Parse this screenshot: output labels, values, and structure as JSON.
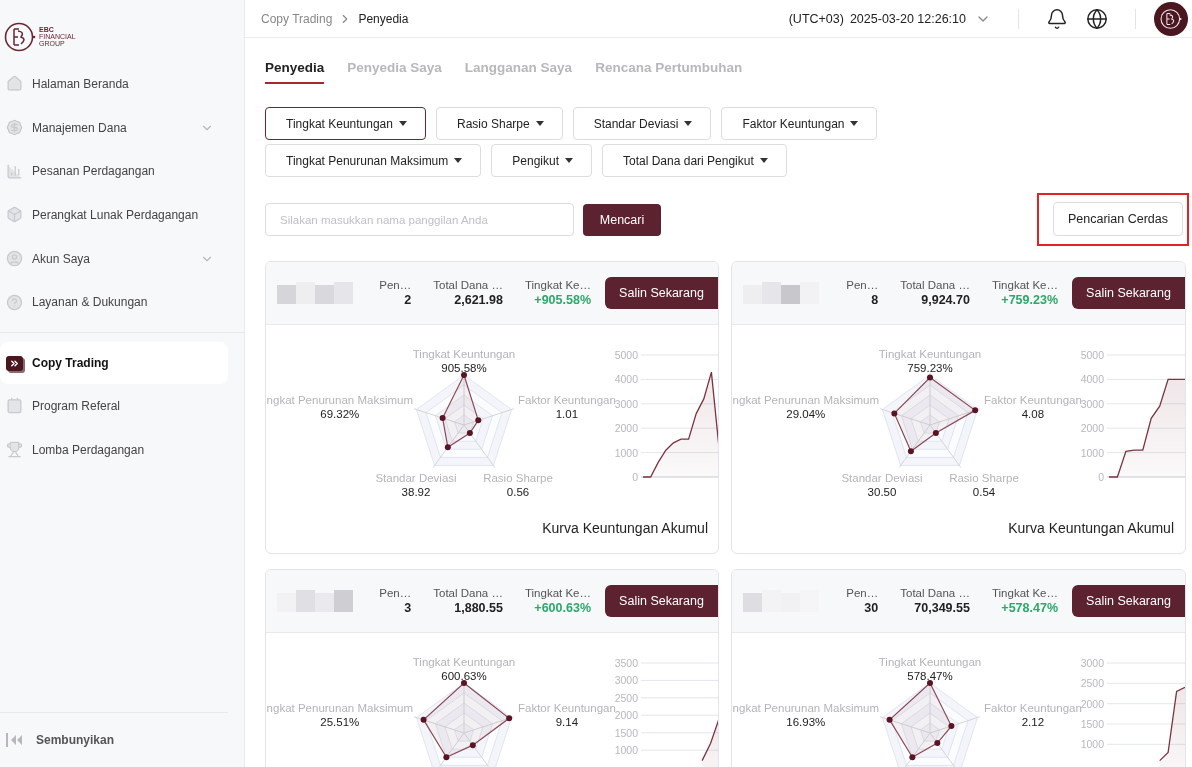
{
  "sidebar": {
    "logo": {
      "lines": [
        "EBC",
        "FINANCIAL",
        "GROUP"
      ]
    },
    "groups": [
      [
        {
          "label": "Halaman Beranda",
          "expandable": false,
          "selected": false
        },
        {
          "label": "Manajemen Dana",
          "expandable": true,
          "selected": false
        },
        {
          "label": "Pesanan Perdagangan",
          "expandable": false,
          "selected": false
        },
        {
          "label": "Perangkat Lunak Perdagangan",
          "expandable": false,
          "selected": false
        },
        {
          "label": "Akun Saya",
          "expandable": true,
          "selected": false
        },
        {
          "label": "Layanan & Dukungan",
          "expandable": false,
          "selected": false
        }
      ],
      [
        {
          "label": "Copy Trading",
          "expandable": false,
          "selected": true
        },
        {
          "label": "Program Referal",
          "expandable": false,
          "selected": false
        },
        {
          "label": "Lomba Perdagangan",
          "expandable": false,
          "selected": false
        }
      ]
    ],
    "collapse": "Sembunyikan"
  },
  "header": {
    "breadcrumb": [
      "Copy Trading",
      "Penyedia"
    ],
    "timezone": "(UTC+03)",
    "datetime": "2025-03-20 12:26:10"
  },
  "tabs": [
    {
      "label": "Penyedia",
      "selected": true
    },
    {
      "label": "Penyedia Saya",
      "selected": false
    },
    {
      "label": "Langganan Saya",
      "selected": false
    },
    {
      "label": "Rencana Pertumbuhan",
      "selected": false
    }
  ],
  "filters": [
    {
      "label": "Tingkat Keuntungan",
      "selected": true
    },
    {
      "label": "Rasio Sharpe",
      "selected": false
    },
    {
      "label": "Standar Deviasi",
      "selected": false
    },
    {
      "label": "Faktor Keuntungan",
      "selected": false
    },
    {
      "label": "Tingkat Penurunan Maksimum",
      "selected": false
    },
    {
      "label": "Pengikut",
      "selected": false
    },
    {
      "label": "Total Dana dari Pengikut",
      "selected": false
    }
  ],
  "search": {
    "placeholder": "Silakan masukkan nama panggilan Anda",
    "button": "Mencari"
  },
  "smart_search": {
    "label": "Pencarian Cerdas",
    "highlighted": true
  },
  "cards": [
    {
      "stats": [
        {
          "label": "Pen…",
          "value": "2",
          "color": "#222222"
        },
        {
          "label": "Total Dana …",
          "value": "2,621.98",
          "color": "#222222"
        },
        {
          "label": "Tingkat Ke…",
          "value": "+905.58%",
          "color": "#2ba86a"
        }
      ],
      "button": "Salin Sekarang",
      "metrics": [
        {
          "label": "Tingkat Keuntungan",
          "value": "905.58%"
        },
        {
          "label": "ngkat Penurunan Maksimum",
          "value": "69.32%"
        },
        {
          "label": "Faktor Keuntungan",
          "value": "1.01"
        },
        {
          "label": "Standar Deviasi",
          "value": "38.92"
        },
        {
          "label": "Rasio Sharpe",
          "value": "0.56"
        }
      ],
      "chart_data": {
        "type": "area",
        "title": "Kurva Keuntungan Akumul",
        "ylim": [
          0,
          5000
        ],
        "yticks": [
          0,
          1000,
          2000,
          3000,
          4000,
          5000
        ],
        "values": [
          0,
          0,
          600,
          1100,
          1400,
          1550,
          1550,
          2600,
          3200,
          4300,
          1200
        ],
        "grid": true
      }
    },
    {
      "stats": [
        {
          "label": "Pen…",
          "value": "8",
          "color": "#222222"
        },
        {
          "label": "Total Dana …",
          "value": "9,924.70",
          "color": "#222222"
        },
        {
          "label": "Tingkat Ke…",
          "value": "+759.23%",
          "color": "#2ba86a"
        }
      ],
      "button": "Salin Sekarang",
      "metrics": [
        {
          "label": "Tingkat Keuntungan",
          "value": "759.23%"
        },
        {
          "label": "ngkat Penurunan Maksimum",
          "value": "29.04%"
        },
        {
          "label": "Faktor Keuntungan",
          "value": "4.08"
        },
        {
          "label": "Standar Deviasi",
          "value": "30.50"
        },
        {
          "label": "Rasio Sharpe",
          "value": "0.54"
        }
      ],
      "chart_data": {
        "type": "area",
        "title": "Kurva Keuntungan Akumul",
        "ylim": [
          0,
          5000
        ],
        "yticks": [
          0,
          1000,
          2000,
          3000,
          4000,
          5000
        ],
        "values": [
          0,
          0,
          1050,
          1100,
          1100,
          2400,
          2900,
          4000,
          4000,
          4000
        ],
        "grid": true
      }
    },
    {
      "stats": [
        {
          "label": "Pen…",
          "value": "3",
          "color": "#222222"
        },
        {
          "label": "Total Dana …",
          "value": "1,880.55",
          "color": "#222222"
        },
        {
          "label": "Tingkat Ke…",
          "value": "+600.63%",
          "color": "#2ba86a"
        }
      ],
      "button": "Salin Sekarang",
      "metrics": [
        {
          "label": "Tingkat Keuntungan",
          "value": "600.63%"
        },
        {
          "label": "ngkat Penurunan Maksimum",
          "value": "25.51%"
        },
        {
          "label": "Faktor Keuntungan",
          "value": "9.14"
        }
      ],
      "chart_data": {
        "type": "area",
        "ylim": [
          0,
          3500
        ],
        "yticks": [
          1000,
          1500,
          2000,
          2500,
          3000,
          3500
        ],
        "values": [
          null,
          null,
          null,
          null,
          null,
          null,
          null,
          700,
          1200,
          1900
        ],
        "grid": true
      }
    },
    {
      "stats": [
        {
          "label": "Pen…",
          "value": "30",
          "color": "#222222"
        },
        {
          "label": "Total Dana …",
          "value": "70,349.55",
          "color": "#222222"
        },
        {
          "label": "Tingkat Ke…",
          "value": "+578.47%",
          "color": "#2ba86a"
        }
      ],
      "button": "Salin Sekarang",
      "metrics": [
        {
          "label": "Tingkat Keuntungan",
          "value": "578.47%"
        },
        {
          "label": "ngkat Penurunan Maksimum",
          "value": "16.93%"
        },
        {
          "label": "Faktor Keuntungan",
          "value": "2.12"
        }
      ],
      "chart_data": {
        "type": "area",
        "ylim": [
          0,
          3000
        ],
        "yticks": [
          1000,
          1500,
          2000,
          2500,
          3000
        ],
        "values": [
          null,
          null,
          null,
          null,
          null,
          null,
          600,
          800,
          2300,
          2400
        ],
        "grid": true
      }
    }
  ]
}
